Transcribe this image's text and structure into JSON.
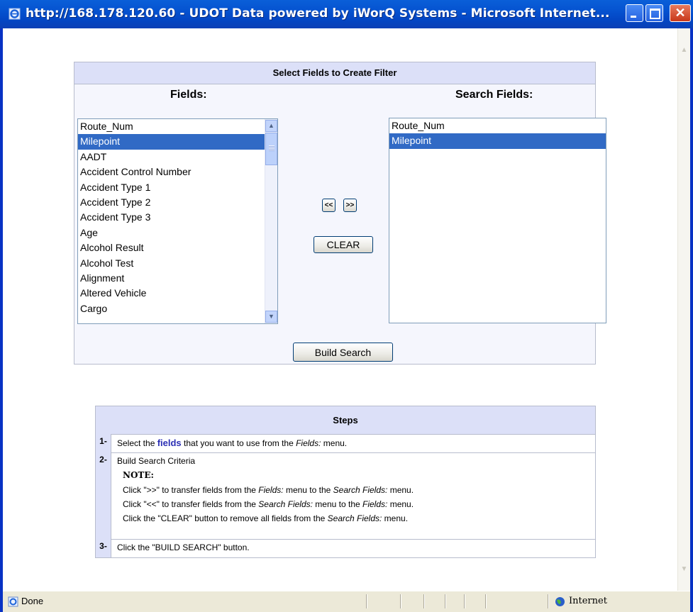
{
  "window": {
    "title": "http://168.178.120.60 - UDOT Data powered by iWorQ Systems - Microsoft Internet...",
    "close_glyph": "✕"
  },
  "filter": {
    "header": "Select Fields to Create Filter",
    "fields_label": "Fields:",
    "search_fields_label": "Search Fields:",
    "fields": [
      {
        "label": "Route_Num",
        "selected": false
      },
      {
        "label": "Milepoint",
        "selected": true
      },
      {
        "label": "AADT",
        "selected": false
      },
      {
        "label": "Accident Control Number",
        "selected": false
      },
      {
        "label": "Accident Type 1",
        "selected": false
      },
      {
        "label": "Accident Type 2",
        "selected": false
      },
      {
        "label": "Accident Type 3",
        "selected": false
      },
      {
        "label": "Age",
        "selected": false
      },
      {
        "label": "Alcohol Result",
        "selected": false
      },
      {
        "label": "Alcohol Test",
        "selected": false
      },
      {
        "label": "Alignment",
        "selected": false
      },
      {
        "label": "Altered Vehicle",
        "selected": false
      },
      {
        "label": "Cargo",
        "selected": false
      }
    ],
    "search_fields": [
      {
        "label": "Route_Num",
        "selected": false
      },
      {
        "label": "Milepoint",
        "selected": true
      }
    ],
    "remove_label": "<<",
    "add_label": ">>",
    "clear_label": "CLEAR",
    "build_label": "Build Search"
  },
  "steps": {
    "header": "Steps",
    "s1_num": "1-",
    "s1_pre": "Select the ",
    "s1_link": "fields",
    "s1_mid": " that you want to use from the ",
    "s1_menu": "Fields:",
    "s1_post": " menu.",
    "s2_num": "2-",
    "s2_title": "Build Search Criteria",
    "note": "NOTE:",
    "n1_pre": "Click \">>\" to transfer fields from the ",
    "n1_a": "Fields:",
    "n1_mid": " menu to the ",
    "n1_b": "Search Fields:",
    "n1_post": " menu.",
    "n2_pre": "Click \"<<\" to transfer fields from the ",
    "n2_a": "Search Fields:",
    "n2_mid": " menu to the ",
    "n2_b": "Fields:",
    "n2_post": " menu.",
    "n3_pre": "Click the \"CLEAR\" button to remove all fields from the ",
    "n3_a": "Search Fields:",
    "n3_post": " menu.",
    "s3_num": "3-",
    "s3_text": "Click the \"BUILD SEARCH\" button."
  },
  "status": {
    "text": "Done",
    "zone": "Internet"
  },
  "colors": {
    "titlebar": "#0552d0",
    "header_bg": "#dce0f8",
    "selection": "#316ac5",
    "link": "#2b2fb4"
  }
}
